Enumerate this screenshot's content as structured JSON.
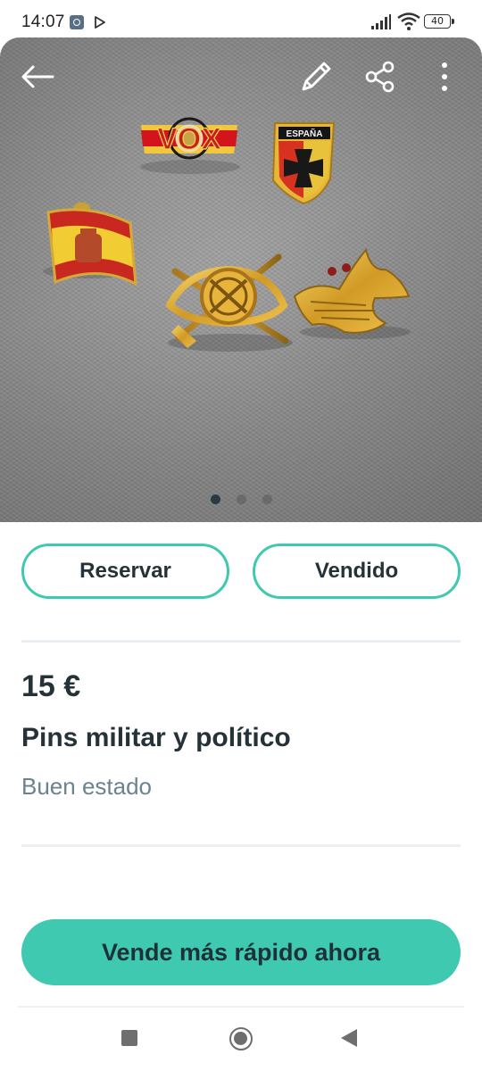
{
  "status_bar": {
    "time": "14:07",
    "battery": "40",
    "icons": [
      "image-notification-icon",
      "play-store-icon",
      "signal-icon",
      "wifi-icon",
      "battery-icon"
    ]
  },
  "photo": {
    "pin_text_vox": "VOX",
    "pin_text_espana": "ESPAÑA",
    "icons": {
      "back": "arrow-left-icon",
      "edit": "pencil-icon",
      "share": "share-icon",
      "more": "more-vertical-icon"
    },
    "image_count": 3,
    "active_image": 1
  },
  "actions": {
    "reserve_label": "Reservar",
    "sold_label": "Vendido"
  },
  "listing": {
    "price": "15 €",
    "title": "Pins militar y político",
    "condition": "Buen estado"
  },
  "cta": {
    "label": "Vende más rápido ahora"
  },
  "colors": {
    "accent": "#3ec9b0",
    "text_dark": "#253238",
    "text_muted": "#6b8390",
    "divider": "#eceff1"
  }
}
